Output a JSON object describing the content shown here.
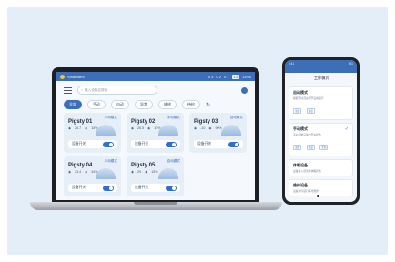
{
  "app": {
    "title": "Smartfarm",
    "window_controls": [
      "0 3",
      "0 2",
      "0 1"
    ],
    "badge": "13",
    "time": "13:00"
  },
  "toolbar": {
    "search_placeholder": "输入设备名搜索"
  },
  "tabs": [
    "全部",
    "手动",
    "自动",
    "异常",
    "维修",
    "待检"
  ],
  "cards": [
    {
      "name": "Pigsty 01",
      "mode": "手动模式",
      "temp": "26.7",
      "humidity": "15%",
      "switch_label": "设备开关",
      "on": true
    },
    {
      "name": "Pigsty 02",
      "mode": "手动模式",
      "temp": "26.5",
      "humidity": "15%",
      "switch_label": "设备开关",
      "on": true
    },
    {
      "name": "Pigsty 03",
      "mode": "自动模式",
      "temp": "-10",
      "humidity": "90%",
      "switch_label": "设备开关",
      "on": true
    },
    {
      "name": "Pigsty 04",
      "mode": "手动模式",
      "temp": "23.4",
      "humidity": "34%",
      "switch_label": "设备开关",
      "on": true
    },
    {
      "name": "Pigsty 05",
      "mode": "自动模式",
      "temp": "29",
      "humidity": "15%",
      "switch_label": "设备开关",
      "on": true
    }
  ],
  "phone": {
    "status_left": "9:41",
    "status_right": "5G",
    "header_title": "工作模式",
    "options": [
      {
        "name": "自动模式",
        "desc": "根据环境自动调节设备运行",
        "chips": [
          "温度",
          "湿度"
        ],
        "checked": false
      },
      {
        "name": "手动模式",
        "desc": "手动控制设备的开关状态",
        "chips": [
          "温度",
          "湿度",
          "光照"
        ],
        "checked": true
      },
      {
        "name": "休眠设备",
        "desc": "设备进入低功耗休眠状态",
        "chips": [],
        "checked": false
      },
      {
        "name": "维修设备",
        "desc": "设备暂停运行等待维修",
        "chips": [],
        "checked": false
      }
    ]
  },
  "colors": {
    "accent": "#3d6fb8",
    "background": "#e3eef8",
    "card": "#e6eef8"
  }
}
